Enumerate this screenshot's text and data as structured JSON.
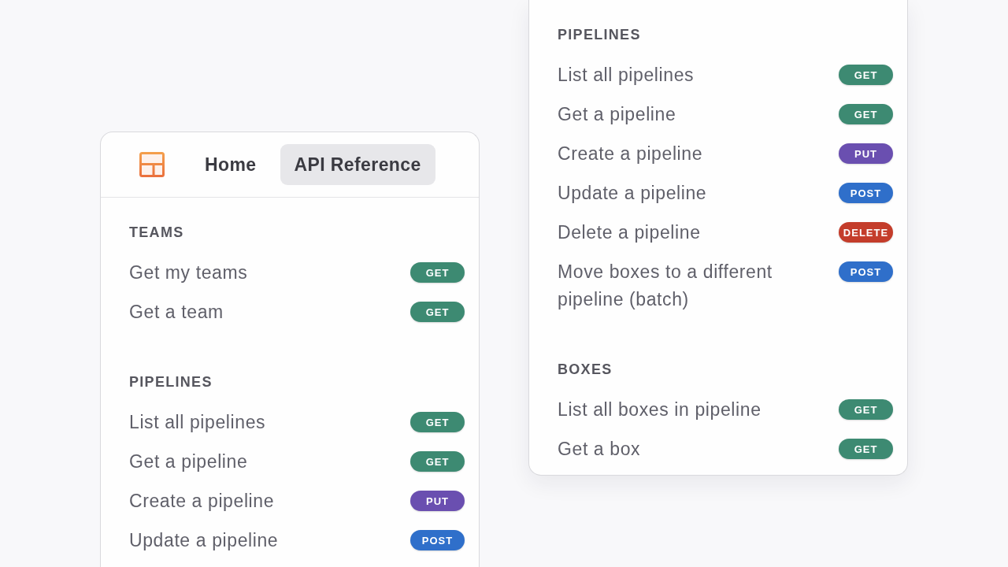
{
  "left_panel": {
    "tabs": [
      {
        "label": "Home",
        "selected": false
      },
      {
        "label": "API Reference",
        "selected": true
      }
    ],
    "sections": [
      {
        "title": "TEAMS",
        "items": [
          {
            "label": "Get my teams",
            "method": "GET",
            "color": "#3d8a72"
          },
          {
            "label": "Get a team",
            "method": "GET",
            "color": "#3d8a72"
          }
        ]
      },
      {
        "title": "PIPELINES",
        "items": [
          {
            "label": "List all pipelines",
            "method": "GET",
            "color": "#3d8a72"
          },
          {
            "label": "Get a pipeline",
            "method": "GET",
            "color": "#3d8a72"
          },
          {
            "label": "Create a pipeline",
            "method": "PUT",
            "color": "#6a4fb0"
          },
          {
            "label": "Update a pipeline",
            "method": "POST",
            "color": "#2f6fca"
          }
        ]
      }
    ]
  },
  "right_panel": {
    "sections": [
      {
        "title": "PIPELINES",
        "items": [
          {
            "label": "List all pipelines",
            "method": "GET",
            "color": "#3d8a72"
          },
          {
            "label": "Get a pipeline",
            "method": "GET",
            "color": "#3d8a72"
          },
          {
            "label": "Create a pipeline",
            "method": "PUT",
            "color": "#6a4fb0"
          },
          {
            "label": "Update a pipeline",
            "method": "POST",
            "color": "#2f6fca"
          },
          {
            "label": "Delete a pipeline",
            "method": "DELETE",
            "color": "#c43d2b"
          },
          {
            "label": "Move boxes to a different pipeline (batch)",
            "method": "POST",
            "color": "#2f6fca"
          }
        ]
      },
      {
        "title": "BOXES",
        "items": [
          {
            "label": "List all boxes in pipeline",
            "method": "GET",
            "color": "#3d8a72"
          },
          {
            "label": "Get a box",
            "method": "GET",
            "color": "#3d8a72"
          }
        ]
      }
    ]
  }
}
